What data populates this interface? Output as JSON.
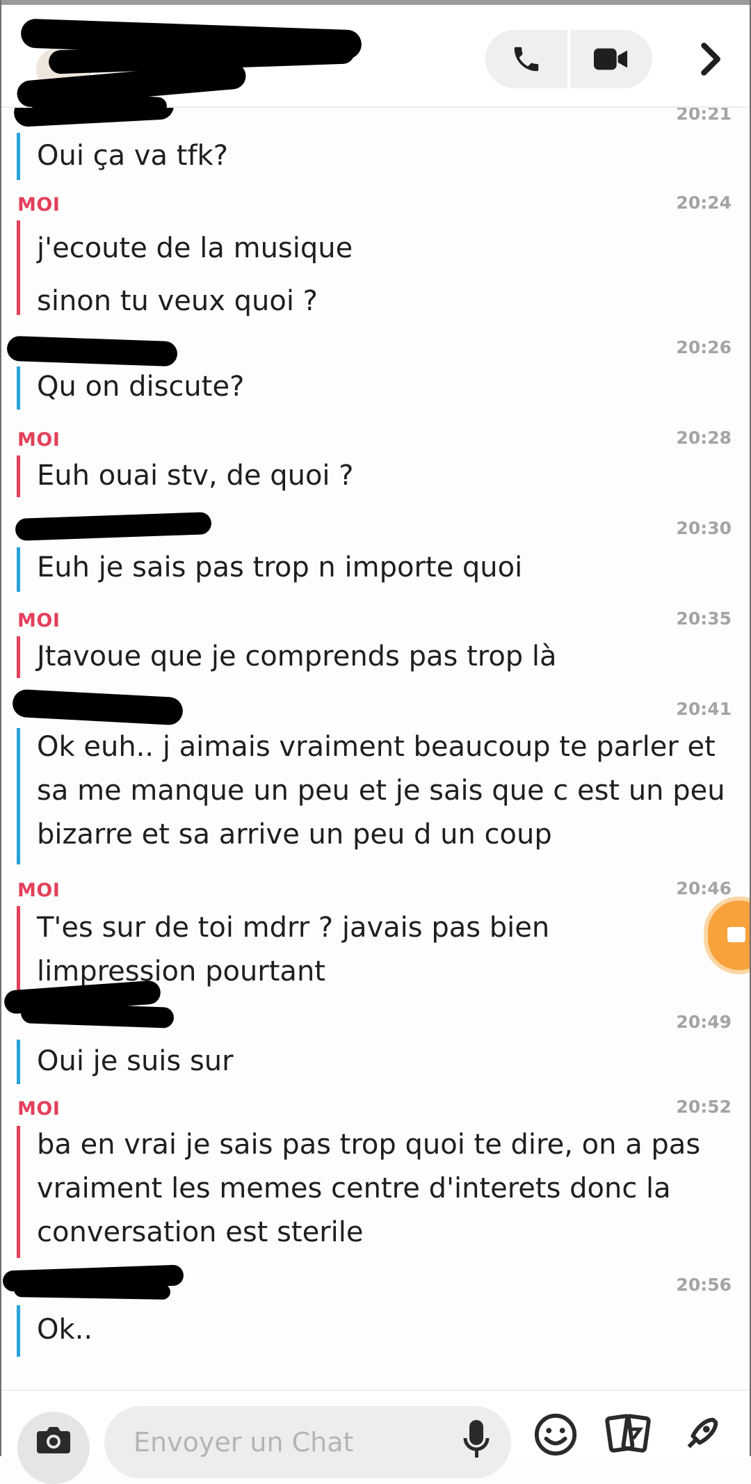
{
  "header": {
    "call_icon": "phone-icon",
    "video_icon": "video-camera-icon",
    "more_icon": "chevron-right-icon"
  },
  "colors": {
    "me": "#e2405a",
    "them": "#2aa1da",
    "time": "#a4a4a4"
  },
  "messages": [
    {
      "from": "them",
      "sender": "",
      "time": "20:21",
      "lines": [
        "Oui ça va tfk?"
      ]
    },
    {
      "from": "me",
      "sender": "MOI",
      "time": "20:24",
      "lines": [
        "j'ecoute de la musique",
        "sinon tu veux quoi ?"
      ]
    },
    {
      "from": "them",
      "sender": "",
      "time": "20:26",
      "lines": [
        "Qu on discute?"
      ]
    },
    {
      "from": "me",
      "sender": "MOI",
      "time": "20:28",
      "lines": [
        "Euh ouai stv, de quoi ?"
      ]
    },
    {
      "from": "them",
      "sender": "",
      "time": "20:30",
      "lines": [
        "Euh je sais pas trop n importe quoi"
      ]
    },
    {
      "from": "me",
      "sender": "MOI",
      "time": "20:35",
      "lines": [
        "Jtavoue que je comprends pas trop là"
      ]
    },
    {
      "from": "them",
      "sender": "",
      "time": "20:41",
      "lines": [
        "Ok euh.. j aimais vraiment beaucoup te parler et sa me manque un peu et je sais que c est un peu bizarre et sa arrive un peu d un coup"
      ]
    },
    {
      "from": "me",
      "sender": "MOI",
      "time": "20:46",
      "lines": [
        "T'es sur de toi mdrr ? javais pas bien limpression pourtant"
      ]
    },
    {
      "from": "them",
      "sender": "",
      "time": "20:49",
      "lines": [
        "Oui je suis sur"
      ]
    },
    {
      "from": "me",
      "sender": "MOI",
      "time": "20:52",
      "lines": [
        "ba en vrai je sais pas trop quoi te dire, on a pas vraiment les memes centre d'interets donc la conversation est sterile"
      ]
    },
    {
      "from": "them",
      "sender": "",
      "time": "20:56",
      "lines": [
        "Ok.."
      ]
    }
  ],
  "composer": {
    "placeholder": "Envoyer un Chat",
    "camera_icon": "camera-icon",
    "mic_icon": "microphone-icon",
    "emoji_icon": "smiley-icon",
    "stickers_icon": "sticker-cards-icon",
    "games_icon": "rocket-icon"
  }
}
